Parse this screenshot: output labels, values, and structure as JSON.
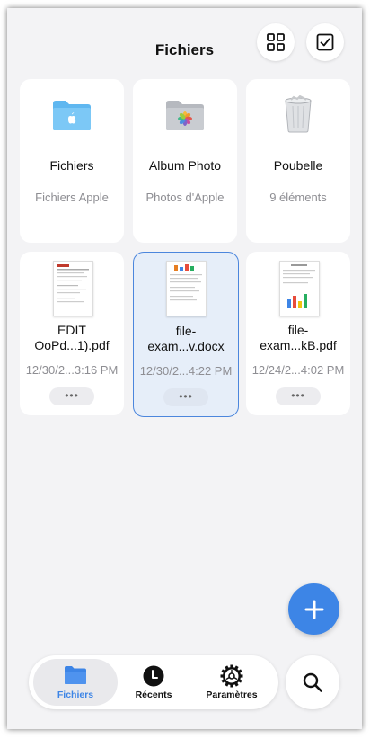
{
  "header": {
    "title": "Fichiers"
  },
  "icons": {
    "grid": "grid-view-icon",
    "select": "checkbox-select-icon",
    "add": "plus-icon",
    "search": "search-icon"
  },
  "locations": [
    {
      "name": "Fichiers",
      "subtitle": "Fichiers Apple",
      "icon": "apple-folder-icon"
    },
    {
      "name": "Album Photo",
      "subtitle": "Photos d'Apple",
      "icon": "photos-folder-icon"
    },
    {
      "name": "Poubelle",
      "subtitle": "9 éléments",
      "icon": "trash-icon"
    }
  ],
  "files": [
    {
      "name": "EDIT\nOoPd...1).pdf",
      "date": "12/30/2...3:16 PM",
      "more": "•••",
      "selected": false
    },
    {
      "name": "file-\nexam...v.docx",
      "date": "12/30/2...4:22 PM",
      "more": "•••",
      "selected": true
    },
    {
      "name": "file-\nexam...kB.pdf",
      "date": "12/24/2...4:02 PM",
      "more": "•••",
      "selected": false
    }
  ],
  "tabs": [
    {
      "label": "Fichiers",
      "icon": "folder-icon",
      "active": true
    },
    {
      "label": "Récents",
      "icon": "clock-icon",
      "active": false
    },
    {
      "label": "Paramètres",
      "icon": "settings-icon",
      "active": false
    }
  ],
  "colors": {
    "accent": "#3d85e6",
    "background": "#f3f3f5",
    "secondary_text": "#8e8e93"
  }
}
